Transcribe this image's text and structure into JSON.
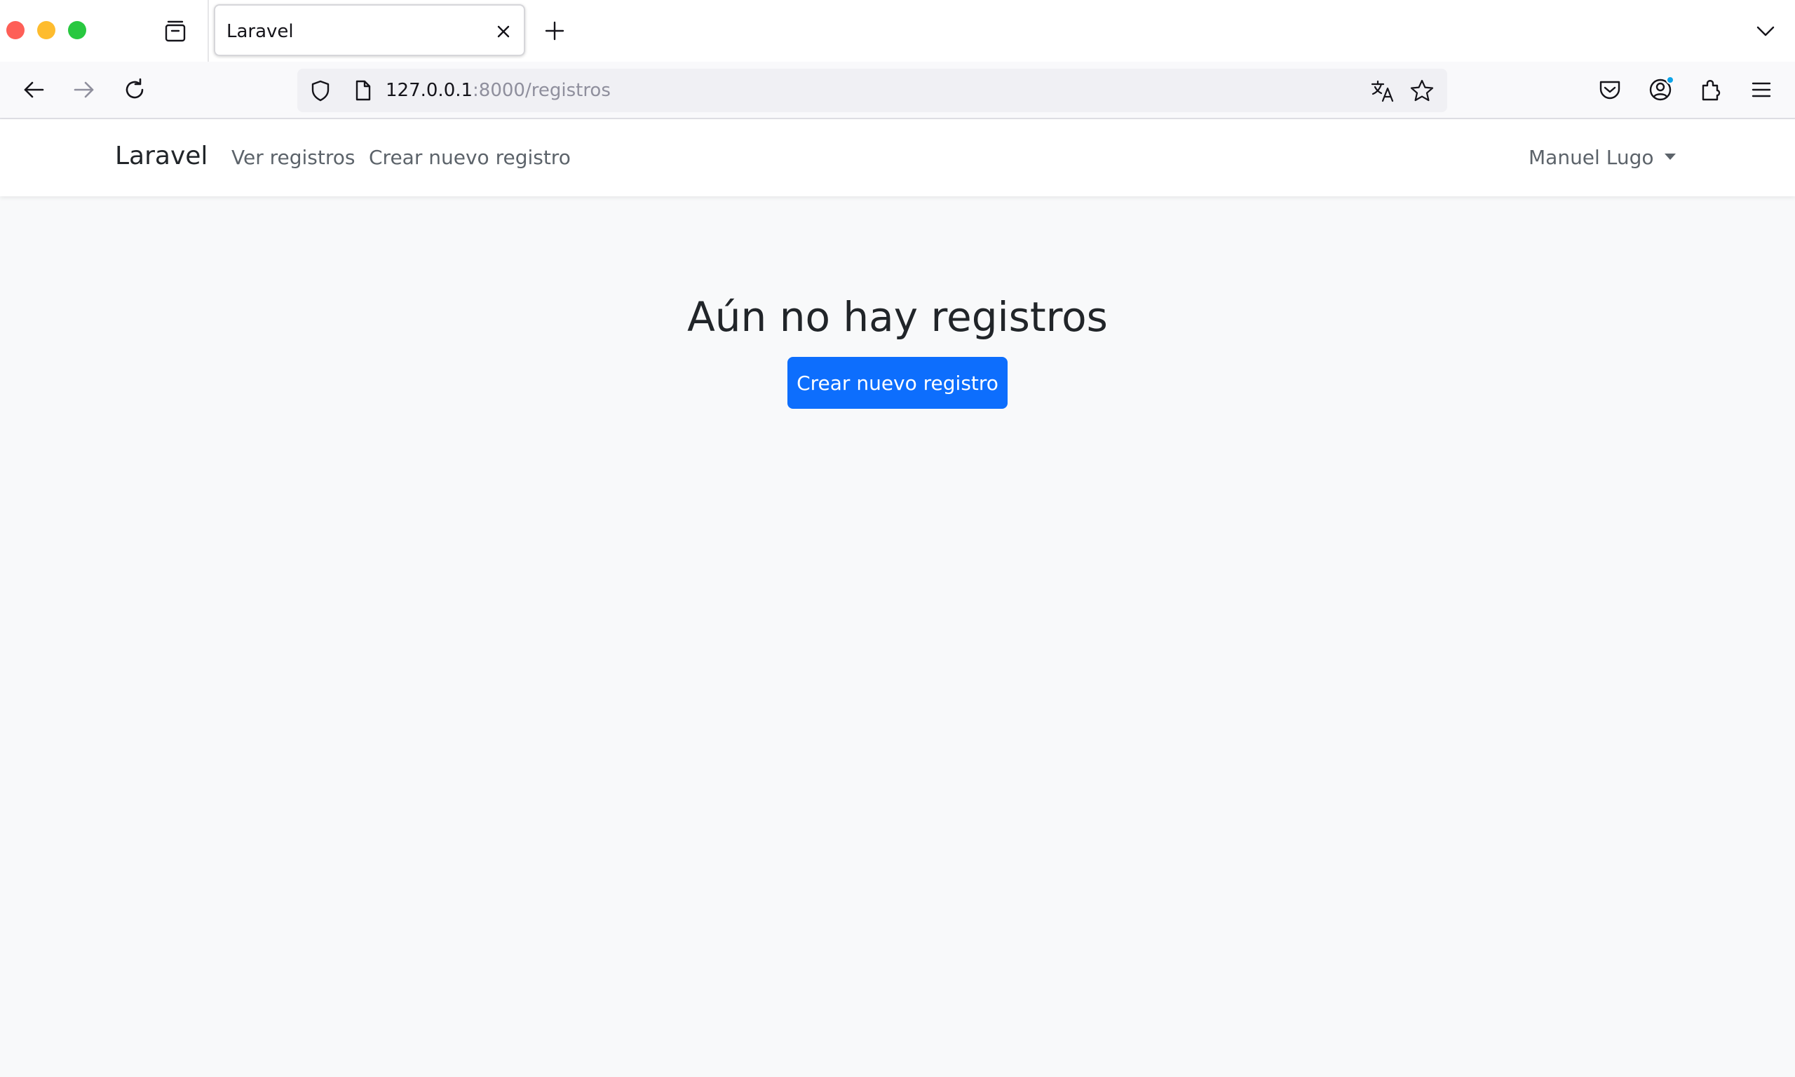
{
  "browser": {
    "tab": {
      "title": "Laravel"
    },
    "url": {
      "host": "127.0.0.1",
      "rest": ":8000/registros"
    }
  },
  "app": {
    "brand": "Laravel",
    "nav": [
      {
        "label": "Ver registros"
      },
      {
        "label": "Crear nuevo registro"
      }
    ],
    "user": {
      "name": "Manuel Lugo"
    }
  },
  "main": {
    "heading": "Aún no hay registros",
    "cta_label": "Crear nuevo registro"
  },
  "colors": {
    "primary": "#0d6efd",
    "page_bg": "#f8f9fa"
  }
}
